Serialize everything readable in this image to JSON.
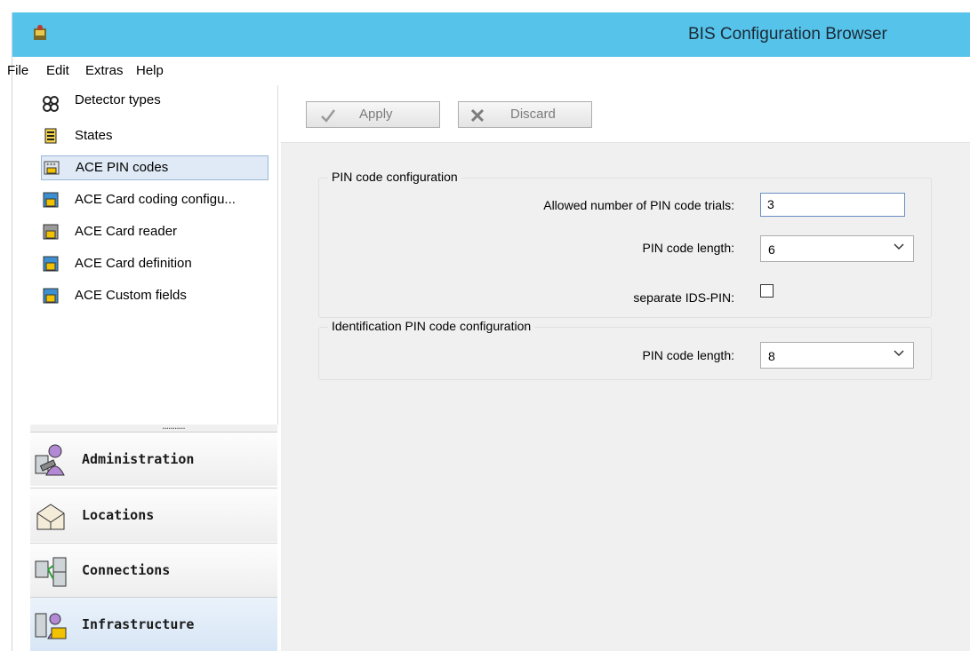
{
  "window": {
    "title": "BIS Configuration Browser"
  },
  "menu": [
    "File",
    "Edit",
    "Extras",
    "Help"
  ],
  "tree": {
    "items": [
      {
        "label": "Detector types",
        "icon": "detector-types-icon",
        "selected": false
      },
      {
        "label": "States",
        "icon": "states-icon",
        "selected": false
      },
      {
        "label": "ACE PIN codes",
        "icon": "ace-pin-codes-icon",
        "selected": true
      },
      {
        "label": "ACE Card coding configu...",
        "icon": "ace-card-coding-icon",
        "selected": false
      },
      {
        "label": "ACE Card reader",
        "icon": "ace-card-reader-icon",
        "selected": false
      },
      {
        "label": "ACE Card definition",
        "icon": "ace-card-definition-icon",
        "selected": false
      },
      {
        "label": "ACE Custom fields",
        "icon": "ace-custom-fields-icon",
        "selected": false
      }
    ],
    "splitter_dots": "..........."
  },
  "nav": [
    {
      "label": "Administration",
      "icon": "administration-icon",
      "active": false
    },
    {
      "label": "Locations",
      "icon": "locations-icon",
      "active": false
    },
    {
      "label": "Connections",
      "icon": "connections-icon",
      "active": false
    },
    {
      "label": "Infrastructure",
      "icon": "infrastructure-icon",
      "active": true
    }
  ],
  "toolbar": {
    "apply_label": "Apply",
    "discard_label": "Discard"
  },
  "pin_config": {
    "legend": "PIN code configuration",
    "trials_label": "Allowed number of PIN code trials:",
    "trials_value": "3",
    "length_label": "PIN code length:",
    "length_value": "6",
    "ids_label": "separate IDS-PIN:",
    "ids_checked": false
  },
  "id_pin_config": {
    "legend": "Identification PIN code configuration",
    "length_label": "PIN code length:",
    "length_value": "8"
  },
  "colors": {
    "titlebar": "#56c3ea",
    "selection": "#dfeaf6",
    "panel": "#f0f0f0"
  }
}
